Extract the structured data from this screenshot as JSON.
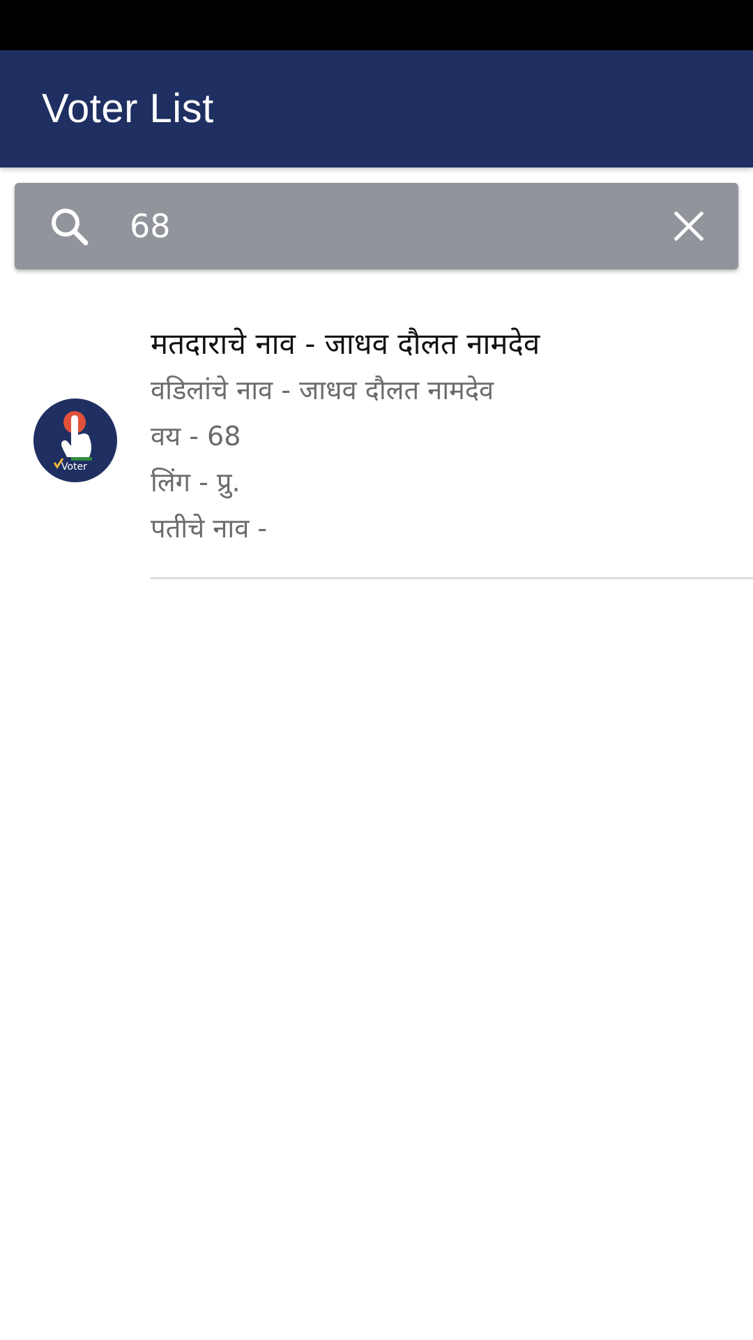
{
  "app_bar": {
    "title": "Voter List",
    "background": "#1f2f61"
  },
  "search": {
    "value": "68",
    "icon": "search-icon",
    "clear_icon": "close-icon"
  },
  "results": [
    {
      "avatar_text": "Voter",
      "voter_name": "मतदाराचे नाव - जाधव दौलत नामदेव",
      "father_name": "वडिलांचे नाव - जाधव दौलत नामदेव",
      "age": "वय - 68",
      "gender": "लिंग - प्रु.",
      "husband_name": "पतीचे नाव -"
    }
  ]
}
